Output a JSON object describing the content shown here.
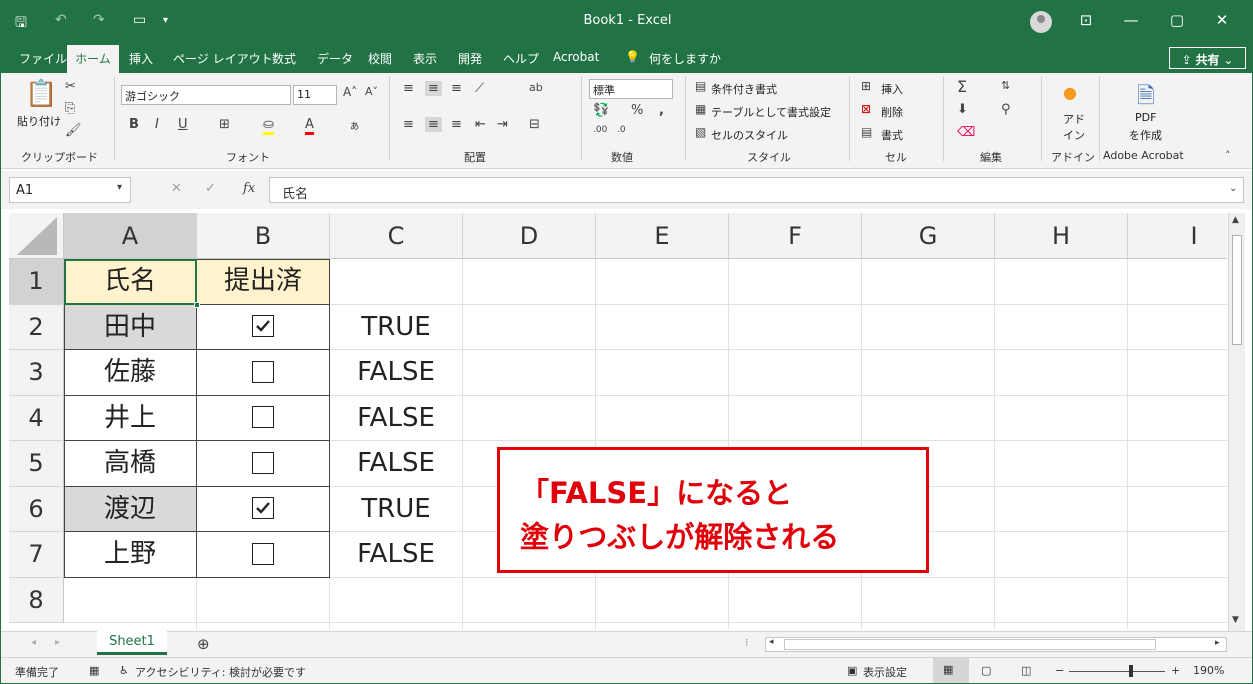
{
  "window": {
    "title": "Book1  -  Excel",
    "share_label": "共有"
  },
  "menu": {
    "tabs": [
      "ファイル",
      "ホーム",
      "挿入",
      "ページ レイアウト",
      "数式",
      "データ",
      "校閲",
      "表示",
      "開発",
      "ヘルプ",
      "Acrobat",
      "何をしますか"
    ]
  },
  "ribbon": {
    "clipboard": {
      "paste": "貼り付け",
      "label": "クリップボード"
    },
    "font": {
      "name": "游ゴシック",
      "size": "11",
      "label": "フォント"
    },
    "alignment": {
      "label": "配置"
    },
    "number": {
      "format": "標準",
      "label": "数値"
    },
    "styles": {
      "conditional": "条件付き書式",
      "as_table": "テーブルとして書式設定",
      "cell_styles": "セルのスタイル",
      "label": "スタイル"
    },
    "cells": {
      "insert": "挿入",
      "delete": "削除",
      "format": "書式",
      "label": "セル"
    },
    "editing": {
      "label": "編集"
    },
    "addins": {
      "l1": "アド",
      "l2": "イン",
      "label": "アドイン"
    },
    "acrobat": {
      "l1": "PDF",
      "l2": "を作成",
      "label": "Adobe Acrobat"
    }
  },
  "formula_bar": {
    "name_box": "A1",
    "fx": "fx",
    "content": "氏名"
  },
  "grid": {
    "columns": [
      "A",
      "B",
      "C",
      "D",
      "E",
      "F",
      "G",
      "H",
      "I"
    ],
    "rows": [
      "1",
      "2",
      "3",
      "4",
      "5",
      "6",
      "7",
      "8"
    ],
    "header": {
      "a": "氏名",
      "b": "提出済"
    },
    "records": [
      {
        "name": "田中",
        "checked": true,
        "value": "TRUE"
      },
      {
        "name": "佐藤",
        "checked": false,
        "value": "FALSE"
      },
      {
        "name": "井上",
        "checked": false,
        "value": "FALSE"
      },
      {
        "name": "高橋",
        "checked": false,
        "value": "FALSE"
      },
      {
        "name": "渡辺",
        "checked": true,
        "value": "TRUE"
      },
      {
        "name": "上野",
        "checked": false,
        "value": "FALSE"
      }
    ],
    "highlight_color": "#d9d9d9",
    "header_fill": "#fff2cc"
  },
  "callout": {
    "line1": "「FALSE」になると",
    "line2": "塗りつぶしが解除される",
    "color": "#e0000a"
  },
  "sheets": {
    "tabs": [
      "Sheet1"
    ]
  },
  "status": {
    "ready": "準備完了",
    "accessibility": "アクセシビリティ: 検討が必要です",
    "display_settings": "表示設定",
    "zoom": "190%"
  },
  "colors": {
    "brand": "#217346"
  }
}
